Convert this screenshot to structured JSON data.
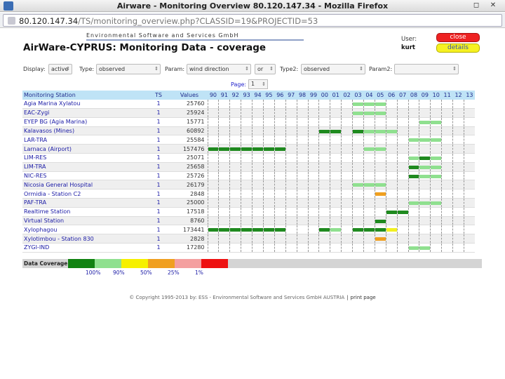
{
  "window": {
    "title": "Airware - Monitoring Overview 80.120.147.34 - Mozilla Firefox",
    "controls": [
      "◻",
      "✕"
    ]
  },
  "browser": {
    "url_host": "80.120.147.34",
    "url_path": "/TS/monitoring_overview.php?CLASSID=19&PROJECTID=53"
  },
  "header": {
    "company": "Environmental Software and Services GmbH",
    "title": "AirWare-CYPRUS:   Monitoring Data - coverage",
    "user_label": "User:",
    "user_name": "kurt",
    "close_label": "close",
    "details_label": "details"
  },
  "filters": {
    "display_label": "Display:",
    "display_value": "active",
    "type_label": "Type:",
    "type_value": "observed",
    "param_label": "Param:",
    "param_value": "wind direction",
    "or_value": "or",
    "type2_label": "Type2:",
    "type2_value": "observed",
    "param2_label": "Param2:",
    "param2_value": ""
  },
  "pager": {
    "label": "Page:",
    "value": "1"
  },
  "table": {
    "col_station": "Monitoring Station",
    "col_ts": "TS",
    "col_values": "Values",
    "years": [
      "90",
      "91",
      "92",
      "93",
      "94",
      "95",
      "96",
      "97",
      "98",
      "99",
      "00",
      "01",
      "02",
      "03",
      "04",
      "05",
      "06",
      "07",
      "08",
      "09",
      "10",
      "11",
      "12",
      "13"
    ],
    "rows": [
      {
        "name": "Agia Marina Xylatou",
        "ts": "1",
        "values": "25760",
        "bars": [
          [
            13,
            3,
            "#8fe08f"
          ]
        ]
      },
      {
        "name": "EAC-Zygi",
        "ts": "1",
        "values": "25924",
        "bars": [
          [
            13,
            3,
            "#8fe08f"
          ]
        ]
      },
      {
        "name": "EYEP BG (Agia Marina)",
        "ts": "1",
        "values": "15771",
        "bars": [
          [
            19,
            2,
            "#8fe08f"
          ]
        ]
      },
      {
        "name": "Kalavasos (Mines)",
        "ts": "1",
        "values": "60892",
        "bars": [
          [
            10,
            2,
            "#1f8a1f"
          ],
          [
            13,
            1,
            "#1f8a1f"
          ],
          [
            14,
            3,
            "#8fe08f"
          ]
        ]
      },
      {
        "name": "LAR-TRA",
        "ts": "1",
        "values": "25584",
        "bars": [
          [
            18,
            3,
            "#8fe08f"
          ]
        ]
      },
      {
        "name": "Larnaca (Airport)",
        "ts": "1",
        "values": "157476",
        "bars": [
          [
            0,
            7,
            "#1f8a1f"
          ],
          [
            14,
            2,
            "#8fe08f"
          ]
        ]
      },
      {
        "name": "LIM-RES",
        "ts": "1",
        "values": "25071",
        "bars": [
          [
            18,
            1,
            "#8fe08f"
          ],
          [
            19,
            1,
            "#1f8a1f"
          ],
          [
            20,
            1,
            "#8fe08f"
          ]
        ]
      },
      {
        "name": "LIM-TRA",
        "ts": "1",
        "values": "25658",
        "bars": [
          [
            18,
            1,
            "#1f8a1f"
          ],
          [
            19,
            2,
            "#8fe08f"
          ]
        ]
      },
      {
        "name": "NIC-RES",
        "ts": "1",
        "values": "25726",
        "bars": [
          [
            18,
            1,
            "#1f8a1f"
          ],
          [
            19,
            2,
            "#8fe08f"
          ]
        ]
      },
      {
        "name": "Nicosia General Hospital",
        "ts": "1",
        "values": "26179",
        "bars": [
          [
            13,
            3,
            "#8fe08f"
          ]
        ]
      },
      {
        "name": "Ormidia - Station C2",
        "ts": "1",
        "values": "2848",
        "bars": [
          [
            15,
            1,
            "#f0a020"
          ]
        ]
      },
      {
        "name": "PAF-TRA",
        "ts": "1",
        "values": "25000",
        "bars": [
          [
            18,
            3,
            "#8fe08f"
          ]
        ]
      },
      {
        "name": "Realtime Station",
        "ts": "1",
        "values": "17518",
        "bars": [
          [
            16,
            2,
            "#1f8a1f"
          ]
        ]
      },
      {
        "name": "Virtual Station",
        "ts": "1",
        "values": "8760",
        "bars": [
          [
            15,
            1,
            "#1f8a1f"
          ]
        ]
      },
      {
        "name": "Xylophagou",
        "ts": "1",
        "values": "173441",
        "bars": [
          [
            0,
            7,
            "#1f8a1f"
          ],
          [
            10,
            1,
            "#1f8a1f"
          ],
          [
            11,
            1,
            "#8fe08f"
          ],
          [
            13,
            3,
            "#1f8a1f"
          ],
          [
            16,
            1,
            "#f2f020"
          ]
        ]
      },
      {
        "name": "Xylotimbou - Station 830",
        "ts": "1",
        "values": "2828",
        "bars": [
          [
            15,
            1,
            "#f0a020"
          ]
        ]
      },
      {
        "name": "ZYGI-IND",
        "ts": "1",
        "values": "17280",
        "bars": [
          [
            18,
            2,
            "#8fe08f"
          ]
        ]
      }
    ]
  },
  "legend": {
    "title": "Data Coverage",
    "colors": [
      "#128212",
      "#8fe08f",
      "#f6f000",
      "#f0a020",
      "#f4a0a0",
      "#ee1111"
    ],
    "labels": [
      "100%",
      "90%",
      "50%",
      "25%",
      "1%"
    ]
  },
  "footer": {
    "copyright": "© Copyright 1995-2013 by:  ESS - Environmental Software and Services GmbH AUSTRIA",
    "separator": "|",
    "print": "print page"
  }
}
